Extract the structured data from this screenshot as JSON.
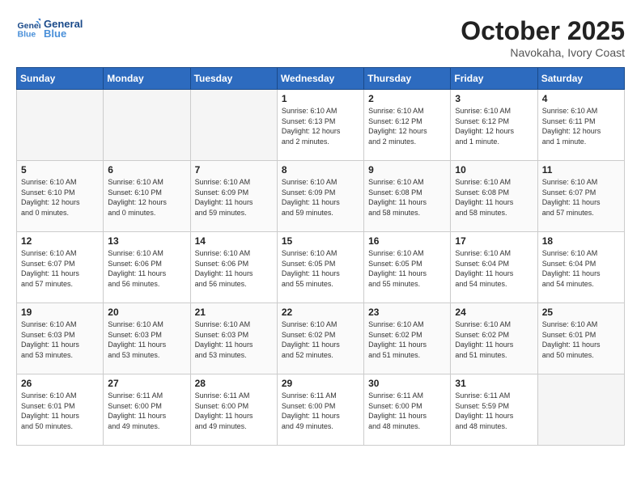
{
  "header": {
    "logo_text_general": "General",
    "logo_text_blue": "Blue",
    "month_title": "October 2025",
    "location": "Navokaha, Ivory Coast"
  },
  "weekdays": [
    "Sunday",
    "Monday",
    "Tuesday",
    "Wednesday",
    "Thursday",
    "Friday",
    "Saturday"
  ],
  "weeks": [
    [
      {
        "day": "",
        "info": ""
      },
      {
        "day": "",
        "info": ""
      },
      {
        "day": "",
        "info": ""
      },
      {
        "day": "1",
        "info": "Sunrise: 6:10 AM\nSunset: 6:13 PM\nDaylight: 12 hours\nand 2 minutes."
      },
      {
        "day": "2",
        "info": "Sunrise: 6:10 AM\nSunset: 6:12 PM\nDaylight: 12 hours\nand 2 minutes."
      },
      {
        "day": "3",
        "info": "Sunrise: 6:10 AM\nSunset: 6:12 PM\nDaylight: 12 hours\nand 1 minute."
      },
      {
        "day": "4",
        "info": "Sunrise: 6:10 AM\nSunset: 6:11 PM\nDaylight: 12 hours\nand 1 minute."
      }
    ],
    [
      {
        "day": "5",
        "info": "Sunrise: 6:10 AM\nSunset: 6:10 PM\nDaylight: 12 hours\nand 0 minutes."
      },
      {
        "day": "6",
        "info": "Sunrise: 6:10 AM\nSunset: 6:10 PM\nDaylight: 12 hours\nand 0 minutes."
      },
      {
        "day": "7",
        "info": "Sunrise: 6:10 AM\nSunset: 6:09 PM\nDaylight: 11 hours\nand 59 minutes."
      },
      {
        "day": "8",
        "info": "Sunrise: 6:10 AM\nSunset: 6:09 PM\nDaylight: 11 hours\nand 59 minutes."
      },
      {
        "day": "9",
        "info": "Sunrise: 6:10 AM\nSunset: 6:08 PM\nDaylight: 11 hours\nand 58 minutes."
      },
      {
        "day": "10",
        "info": "Sunrise: 6:10 AM\nSunset: 6:08 PM\nDaylight: 11 hours\nand 58 minutes."
      },
      {
        "day": "11",
        "info": "Sunrise: 6:10 AM\nSunset: 6:07 PM\nDaylight: 11 hours\nand 57 minutes."
      }
    ],
    [
      {
        "day": "12",
        "info": "Sunrise: 6:10 AM\nSunset: 6:07 PM\nDaylight: 11 hours\nand 57 minutes."
      },
      {
        "day": "13",
        "info": "Sunrise: 6:10 AM\nSunset: 6:06 PM\nDaylight: 11 hours\nand 56 minutes."
      },
      {
        "day": "14",
        "info": "Sunrise: 6:10 AM\nSunset: 6:06 PM\nDaylight: 11 hours\nand 56 minutes."
      },
      {
        "day": "15",
        "info": "Sunrise: 6:10 AM\nSunset: 6:05 PM\nDaylight: 11 hours\nand 55 minutes."
      },
      {
        "day": "16",
        "info": "Sunrise: 6:10 AM\nSunset: 6:05 PM\nDaylight: 11 hours\nand 55 minutes."
      },
      {
        "day": "17",
        "info": "Sunrise: 6:10 AM\nSunset: 6:04 PM\nDaylight: 11 hours\nand 54 minutes."
      },
      {
        "day": "18",
        "info": "Sunrise: 6:10 AM\nSunset: 6:04 PM\nDaylight: 11 hours\nand 54 minutes."
      }
    ],
    [
      {
        "day": "19",
        "info": "Sunrise: 6:10 AM\nSunset: 6:03 PM\nDaylight: 11 hours\nand 53 minutes."
      },
      {
        "day": "20",
        "info": "Sunrise: 6:10 AM\nSunset: 6:03 PM\nDaylight: 11 hours\nand 53 minutes."
      },
      {
        "day": "21",
        "info": "Sunrise: 6:10 AM\nSunset: 6:03 PM\nDaylight: 11 hours\nand 53 minutes."
      },
      {
        "day": "22",
        "info": "Sunrise: 6:10 AM\nSunset: 6:02 PM\nDaylight: 11 hours\nand 52 minutes."
      },
      {
        "day": "23",
        "info": "Sunrise: 6:10 AM\nSunset: 6:02 PM\nDaylight: 11 hours\nand 51 minutes."
      },
      {
        "day": "24",
        "info": "Sunrise: 6:10 AM\nSunset: 6:02 PM\nDaylight: 11 hours\nand 51 minutes."
      },
      {
        "day": "25",
        "info": "Sunrise: 6:10 AM\nSunset: 6:01 PM\nDaylight: 11 hours\nand 50 minutes."
      }
    ],
    [
      {
        "day": "26",
        "info": "Sunrise: 6:10 AM\nSunset: 6:01 PM\nDaylight: 11 hours\nand 50 minutes."
      },
      {
        "day": "27",
        "info": "Sunrise: 6:11 AM\nSunset: 6:00 PM\nDaylight: 11 hours\nand 49 minutes."
      },
      {
        "day": "28",
        "info": "Sunrise: 6:11 AM\nSunset: 6:00 PM\nDaylight: 11 hours\nand 49 minutes."
      },
      {
        "day": "29",
        "info": "Sunrise: 6:11 AM\nSunset: 6:00 PM\nDaylight: 11 hours\nand 49 minutes."
      },
      {
        "day": "30",
        "info": "Sunrise: 6:11 AM\nSunset: 6:00 PM\nDaylight: 11 hours\nand 48 minutes."
      },
      {
        "day": "31",
        "info": "Sunrise: 6:11 AM\nSunset: 5:59 PM\nDaylight: 11 hours\nand 48 minutes."
      },
      {
        "day": "",
        "info": ""
      }
    ]
  ]
}
